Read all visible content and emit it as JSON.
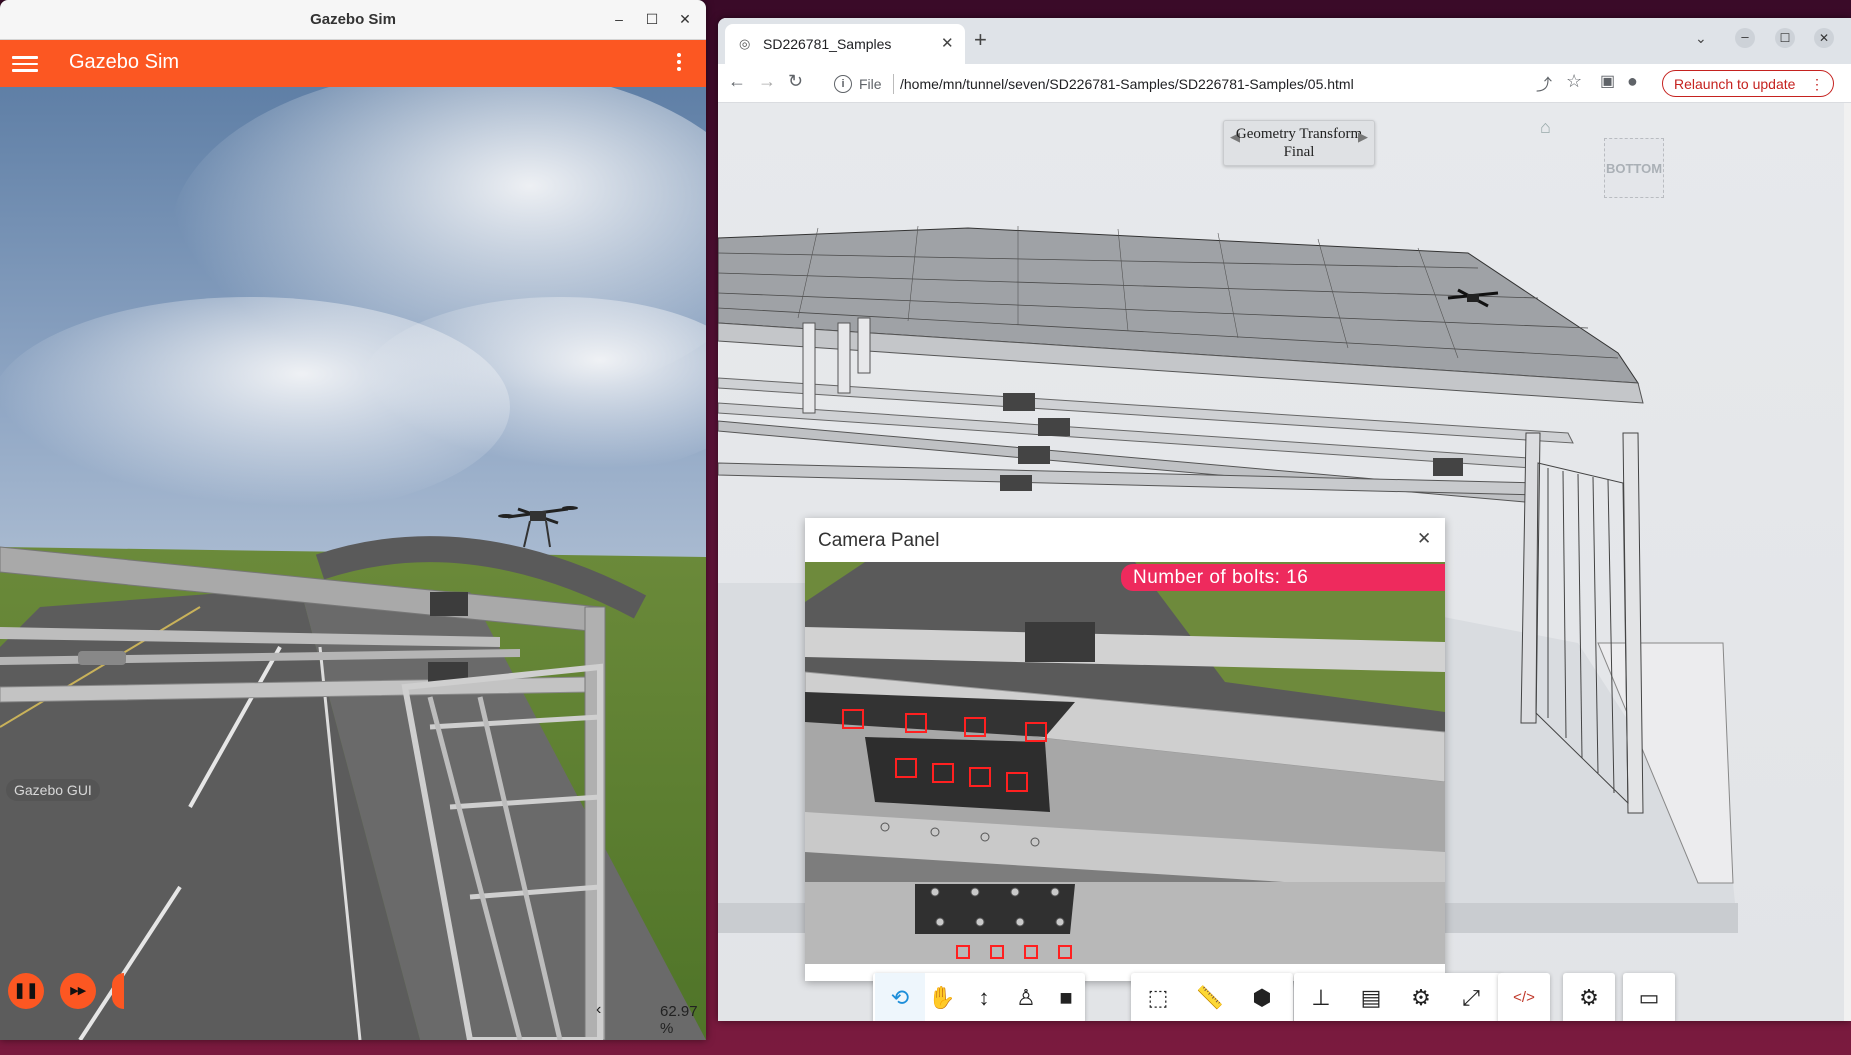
{
  "gazebo": {
    "window_title": "Gazebo Sim",
    "app_title": "Gazebo Sim",
    "gui_label": "Gazebo GUI",
    "rtf": "62.97 %",
    "controls": {
      "pause_glyph": "❚❚",
      "step_glyph": "▸▸"
    }
  },
  "browser": {
    "tab_title": "SD226781_Samples",
    "scheme_label": "File",
    "url": "/home/mn/tunnel/seven/SD226781-Samples/SD226781-Samples/05.html",
    "relaunch_label": "Relaunch to update",
    "accent_color": "#c5221f"
  },
  "viewer": {
    "nav_title": "Geometry Transform",
    "nav_subtitle": "Final",
    "viewcube_label": "BOTTOM",
    "camera_panel": {
      "title": "Camera Panel",
      "bolts_text": "Number of bolts: 16"
    },
    "toolbar_groups": [
      [
        "orbit-icon",
        "pan-icon",
        "zoom-icon",
        "first-person-icon",
        "camera-icon"
      ],
      [
        "section-box-icon",
        "measure-icon",
        "explode-icon"
      ],
      [
        "model-browser-icon",
        "properties-icon",
        "settings-icon",
        "fullscreen-icon"
      ],
      [
        "code-icon"
      ],
      [
        "robot-arm-icon"
      ],
      [
        "video-camera-icon"
      ]
    ]
  },
  "colors": {
    "gazebo_orange": "#fc5722",
    "bolt_badge": "#ee2a5d",
    "active_tool": "#1d8ed9"
  }
}
